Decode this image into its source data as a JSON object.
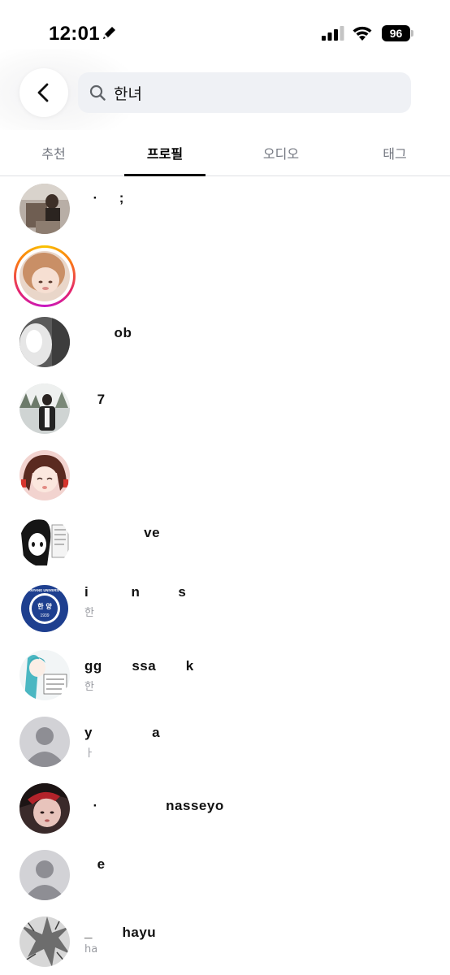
{
  "status_bar": {
    "time": "12:01",
    "battery": "96"
  },
  "search": {
    "query": "한녀",
    "icon": "search-icon"
  },
  "tabs": [
    {
      "label": "추천",
      "active": false
    },
    {
      "label": "프로필",
      "active": true
    },
    {
      "label": "오디오",
      "active": false
    },
    {
      "label": "태그",
      "active": false
    }
  ],
  "results": [
    {
      "username": "  ·     ;",
      "subtitle": "",
      "avatar": "photo-avatar"
    },
    {
      "username": "",
      "subtitle": "",
      "avatar": "photo-avatar",
      "has_story": true
    },
    {
      "username": "       ob",
      "subtitle": "",
      "avatar": "photo-avatar"
    },
    {
      "username": "   7",
      "subtitle": "",
      "avatar": "photo-avatar"
    },
    {
      "username": "",
      "subtitle": "",
      "avatar": "illustration-avatar"
    },
    {
      "username": "              ve",
      "subtitle": "",
      "avatar": "manga-avatar"
    },
    {
      "username": "i          n         s",
      "subtitle": "한",
      "avatar": "university-logo-avatar",
      "logo_text": {
        "top": "HANYANG UNIVERSITY",
        "center": "한 양",
        "year": "1939"
      }
    },
    {
      "username": "gg       ssa       k",
      "subtitle": "한",
      "avatar": "illustration-avatar"
    },
    {
      "username": "y              a",
      "subtitle": "ㅏ",
      "avatar": "default-avatar"
    },
    {
      "username": "  ·                nasseyo",
      "subtitle": "",
      "avatar": "photo-avatar"
    },
    {
      "username": "   e",
      "subtitle": "",
      "avatar": "default-avatar"
    },
    {
      "username": "_       hayu",
      "subtitle": "ha",
      "avatar": "photo-avatar"
    }
  ],
  "colors": {
    "search_bg": "#eff1f5",
    "tab_inactive": "#737780",
    "story_ring": [
      "#f9c300",
      "#fb7a13",
      "#e4256e",
      "#c718c4"
    ],
    "default_avatar_bg": "#d2d2d6",
    "default_avatar_fg": "#8e8e94"
  }
}
